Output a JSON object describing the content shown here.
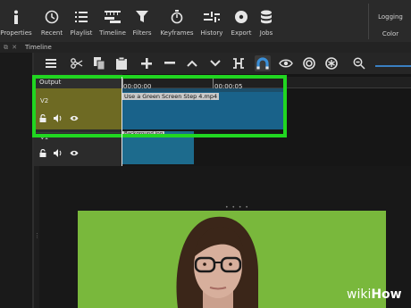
{
  "toolbar": {
    "items": [
      {
        "label": "Properties",
        "icon": "info-icon"
      },
      {
        "label": "Recent",
        "icon": "clock-icon"
      },
      {
        "label": "Playlist",
        "icon": "list-icon"
      },
      {
        "label": "Timeline",
        "icon": "timeline-icon"
      },
      {
        "label": "Filters",
        "icon": "funnel-icon"
      },
      {
        "label": "Keyframes",
        "icon": "stopwatch-icon"
      },
      {
        "label": "History",
        "icon": "history-icon"
      },
      {
        "label": "Export",
        "icon": "disc-icon"
      },
      {
        "label": "Jobs",
        "icon": "database-icon"
      }
    ],
    "layouts": [
      "Logging",
      "Color"
    ]
  },
  "dock": {
    "title": "Timeline"
  },
  "timeline": {
    "output_label": "Output",
    "ruler": [
      "00:00:00",
      "00:00:05"
    ],
    "tracks": [
      {
        "name": "V2",
        "clip": "Use a Green Screen Step 4.mp4"
      },
      {
        "name": "V1",
        "clip": "Background.jpg"
      }
    ]
  },
  "watermark": {
    "part1": "wiki",
    "part2": "How"
  },
  "colors": {
    "accent_highlight": "#21d621",
    "selected_track": "#6e6a23",
    "clip_blue": "#19628a",
    "green_screen": "#79b83c",
    "zoom_slider": "#3a7fc2"
  }
}
